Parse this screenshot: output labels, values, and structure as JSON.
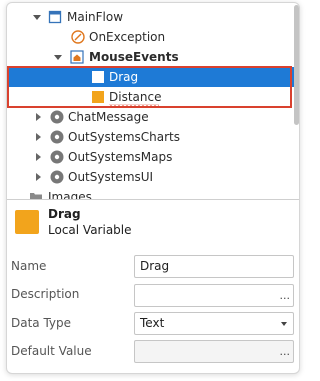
{
  "tree": {
    "items": [
      {
        "label": "MainFlow",
        "icon": "flow-icon"
      },
      {
        "label": "OnException",
        "icon": "exception-handler-icon"
      },
      {
        "label": "MouseEvents",
        "icon": "screen-icon"
      },
      {
        "label": "Drag",
        "icon": "local-variable-icon"
      },
      {
        "label": "Distance",
        "icon": "local-variable-icon"
      },
      {
        "label": "ChatMessage",
        "icon": "module-icon"
      },
      {
        "label": "OutSystemsCharts",
        "icon": "module-icon"
      },
      {
        "label": "OutSystemsMaps",
        "icon": "module-icon"
      },
      {
        "label": "OutSystemsUI",
        "icon": "module-icon"
      },
      {
        "label": "Images",
        "icon": "folder-icon"
      }
    ],
    "selected_color": "#1e7ad6",
    "highlight_color": "#d9412e",
    "variable_color": "#f2a41c"
  },
  "detail": {
    "name": "Drag",
    "kind": "Local Variable"
  },
  "properties": [
    {
      "label": "Name",
      "value": "Drag",
      "control": "text"
    },
    {
      "label": "Description",
      "value": "",
      "control": "ellipsis",
      "button": "..."
    },
    {
      "label": "Data Type",
      "value": "Text",
      "control": "select"
    },
    {
      "label": "Default Value",
      "value": "",
      "control": "ellipsis",
      "button": "..."
    }
  ]
}
